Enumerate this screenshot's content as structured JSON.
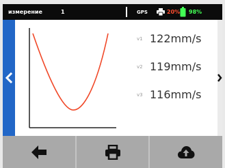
{
  "status_bar": {
    "mode_label": "измерение",
    "measurement_number": "1",
    "gps_label": "GPS",
    "print_level": "20%",
    "battery_level": "98%"
  },
  "readouts": [
    {
      "tag": "v1",
      "value": "122mm/s"
    },
    {
      "tag": "v2",
      "value": "119mm/s"
    },
    {
      "tag": "v3",
      "value": "116mm/s"
    }
  ],
  "icons": {
    "prev": "chevron-left-icon",
    "next": "chevron-right-icon",
    "back": "arrow-left-icon",
    "print": "printer-icon",
    "upload": "cloud-upload-icon",
    "printer_status": "printer-icon",
    "battery": "battery-icon"
  },
  "colors": {
    "status_bar_bg": "#0b0b0b",
    "side_tab_blue": "#2267c7",
    "curve": "#f04828",
    "print_text": "#ff4d2e",
    "battery_text": "#43ff55",
    "bottom_bar_bg": "#a9a9a9"
  }
}
